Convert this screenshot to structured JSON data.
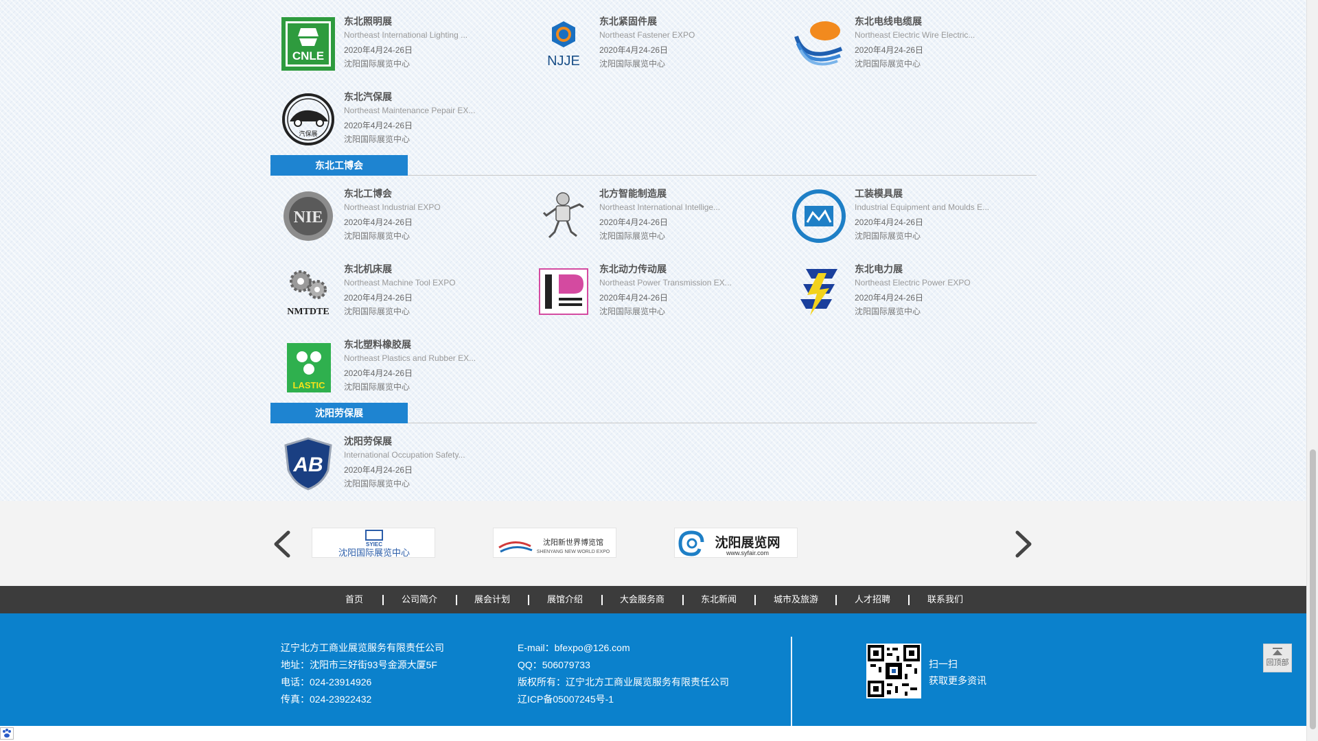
{
  "expos": [
    {
      "name": "东北照明展",
      "en": "Northeast International Lighting ...",
      "date": "2020年4月24-26日",
      "venue": "沈阳国际展览中心",
      "logo_text": "CNLE",
      "icon": "cnle-logo-icon"
    },
    {
      "name": "东北紧固件展",
      "en": "Northeast Fastener EXPO",
      "date": "2020年4月24-26日",
      "venue": "沈阳国际展览中心",
      "logo_text": "NJJE",
      "icon": "njje-logo-icon"
    },
    {
      "name": "东北电线电缆展",
      "en": "Northeast Electric Wire Electric...",
      "date": "2020年4月24-26日",
      "venue": "沈阳国际展览中心",
      "icon": "wire-cable-logo-icon"
    },
    {
      "name": "东北汽保展",
      "en": "Northeast Maintenance Pepair EX...",
      "date": "2020年4月24-26日",
      "venue": "沈阳国际展览中心",
      "logo_text": "汽保展",
      "icon": "car-maintenance-logo-icon"
    },
    {
      "name": "东北工博会",
      "en": "Northeast Industrial EXPO",
      "date": "2020年4月24-26日",
      "venue": "沈阳国际展览中心",
      "logo_text": "NIE",
      "icon": "nie-logo-icon"
    },
    {
      "name": "北方智能制造展",
      "en": "Northeast International Intellige...",
      "date": "2020年4月24-26日",
      "venue": "沈阳国际展览中心",
      "icon": "robot-logo-icon"
    },
    {
      "name": "工装模具展",
      "en": "Industrial Equipment and Moulds E...",
      "date": "2020年4月24-26日",
      "venue": "沈阳国际展览中心",
      "icon": "moulds-logo-icon"
    },
    {
      "name": "东北机床展",
      "en": "Northeast Machine Tool EXPO",
      "date": "2020年4月24-26日",
      "venue": "沈阳国际展览中心",
      "logo_text": "NMTDTE",
      "icon": "gears-logo-icon"
    },
    {
      "name": "东北动力传动展",
      "en": "Northeast Power Transmission EX...",
      "date": "2020年4月24-26日",
      "venue": "沈阳国际展览中心",
      "icon": "power-transmission-logo-icon"
    },
    {
      "name": "东北电力展",
      "en": "Northeast Electric Power EXPO",
      "date": "2020年4月24-26日",
      "venue": "沈阳国际展览中心",
      "icon": "lightning-logo-icon"
    },
    {
      "name": "东北塑料橡胶展",
      "en": "Northeast Plastics and Rubber EX...",
      "date": "2020年4月24-26日",
      "venue": "沈阳国际展览中心",
      "logo_text": "LASTIC",
      "icon": "plastic-logo-icon"
    },
    {
      "name": "沈阳劳保展",
      "en": "International Occupation Safety...",
      "date": "2020年4月24-26日",
      "venue": "沈阳国际展览中心",
      "logo_text": "AB",
      "icon": "ab-shield-logo-icon"
    }
  ],
  "sections": [
    {
      "label": "东北工博会"
    },
    {
      "label": "沈阳劳保展"
    }
  ],
  "partners": [
    {
      "text": "沈阳国际展览中心",
      "sub": "SYIEC",
      "icon": "syiec-logo-icon"
    },
    {
      "text": "沈阳新世界博览馆",
      "sub": "SHENYANG NEW WORLD EXPO",
      "icon": "new-world-expo-logo-icon"
    },
    {
      "text": "沈阳展览网",
      "sub": "www.syfair.com",
      "icon": "syfair-logo-icon"
    }
  ],
  "nav": [
    "首页",
    "公司简介",
    "展会计划",
    "展馆介绍",
    "大会服务商",
    "东北新闻",
    "城市及旅游",
    "人才招聘",
    "联系我们"
  ],
  "footer": {
    "company": "辽宁北方工商业展览服务有限责任公司",
    "address": "地址：沈阳市三好街93号金源大厦5F",
    "phone": "电话：024-23914926",
    "fax": "传真：024-23922432",
    "email": "E-mail：bfexpo@126.com",
    "qq": "QQ：506079733",
    "copyright": "版权所有：辽宁北方工商业展览服务有限责任公司",
    "icp": "辽ICP备05007245号-1",
    "scan1": "扫一扫",
    "scan2": "获取更多资讯"
  },
  "back_to_top": "回顶部",
  "colors": {
    "accent": "#1e84d1",
    "footer": "#0b81cc",
    "nav": "#3c3c3c"
  }
}
